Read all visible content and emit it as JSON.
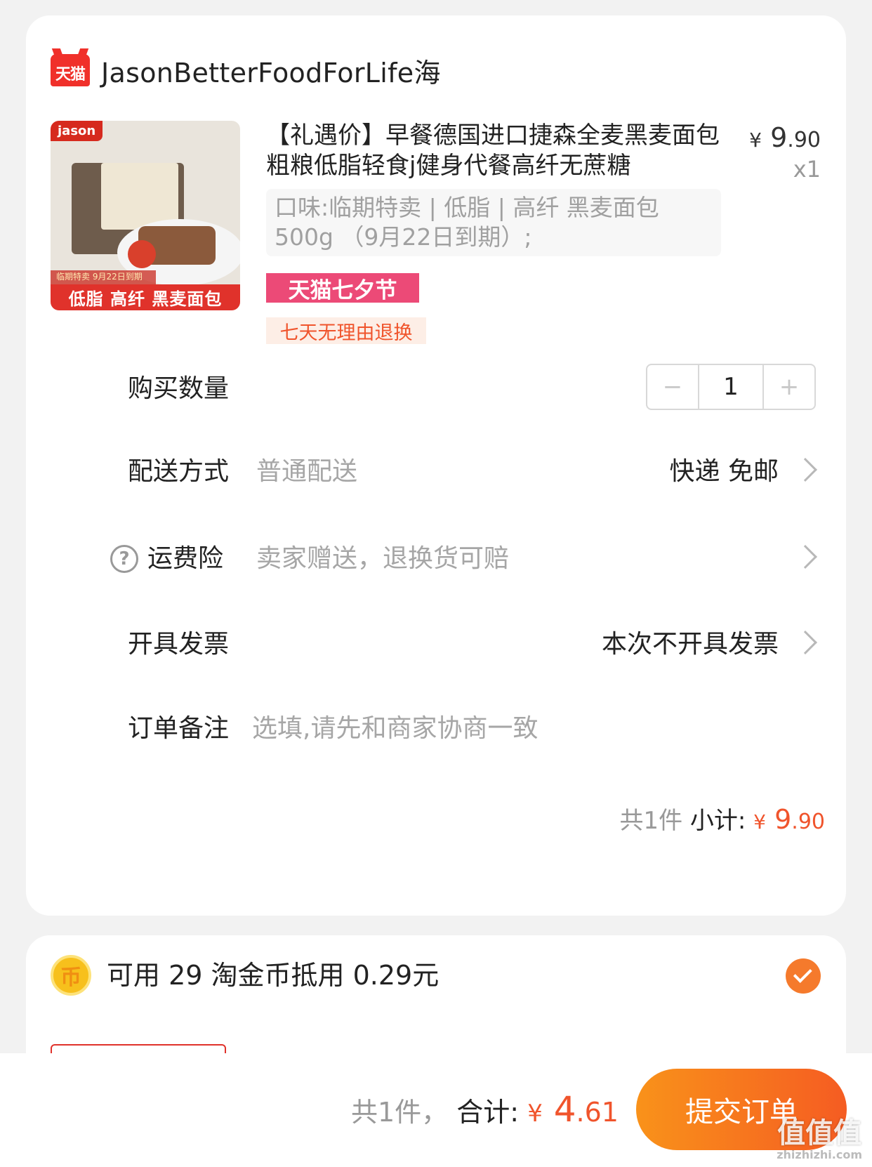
{
  "store": {
    "logo_text": "天猫",
    "name": "JasonBetterFoodForLife海"
  },
  "product": {
    "image": {
      "brand_tag": "jason",
      "expire_note": "临期特卖 9月22日到期",
      "banner": "低脂 高纤 黑麦面包"
    },
    "title": "【礼遇价】早餐德国进口捷森全麦黑麦面包粗粮低脂轻食j健身代餐高纤无蔗糖",
    "price_symbol": "¥",
    "price_int": "9",
    "price_dec": ".90",
    "quantity": "x1",
    "sku": "口味:临期特卖 | 低脂 | 高纤 黑麦面包500g （9月22日到期）;",
    "tag_festival": "天猫七夕节",
    "tag_return": "七天无理由退换"
  },
  "quantity_row": {
    "label": "购买数量",
    "minus": "−",
    "value": "1",
    "plus": "+"
  },
  "delivery_row": {
    "label": "配送方式",
    "sub": "普通配送",
    "value": "快递 免邮"
  },
  "freight_row": {
    "help_icon": "?",
    "label": "运费险",
    "sub": "卖家赠送，退换货可赔"
  },
  "invoice_row": {
    "label": "开具发票",
    "value": "本次不开具发票"
  },
  "note_row": {
    "label": "订单备注",
    "placeholder": "选填,请先和商家协商一致"
  },
  "subtotal": {
    "count": "共1件",
    "label": "小计:",
    "price_symbol": "¥",
    "price_int": "9",
    "price_dec": ".90"
  },
  "coins": {
    "icon": "币",
    "text": "可用 29 淘金币抵用 0.29元",
    "checked": true,
    "accent": "#f57a2c"
  },
  "footer": {
    "count": "共1件，",
    "label": "合计:",
    "price_symbol": "¥",
    "price_int": "4",
    "price_dec": ".61",
    "submit_label": "提交订单",
    "watermark": "值值值",
    "watermark_url": "zhizhizhi.com"
  },
  "colors": {
    "accent": "#f0542c",
    "festival": "#ec4a77",
    "tmall": "#f0302a"
  }
}
